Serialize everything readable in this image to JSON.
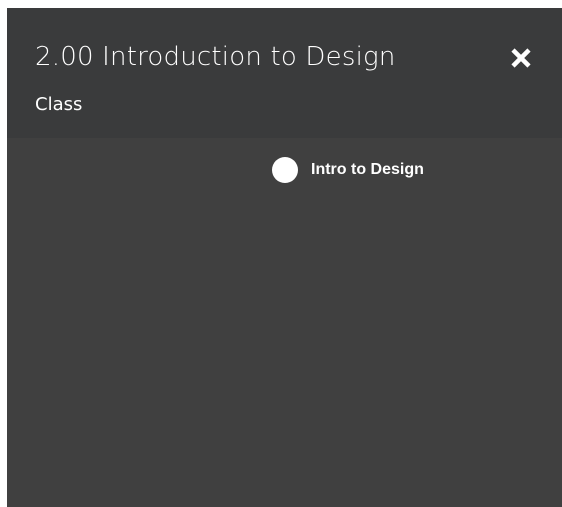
{
  "dialog": {
    "title": "2.00 Introduction to Design",
    "subtitle": "Class",
    "close_icon": "close-icon"
  },
  "items": [
    {
      "label": "Intro to Design",
      "icon": "circle-node-icon"
    }
  ],
  "colors": {
    "panel_background": "#404040",
    "header_background": "#3a3b3c",
    "text": "#ffffff"
  }
}
